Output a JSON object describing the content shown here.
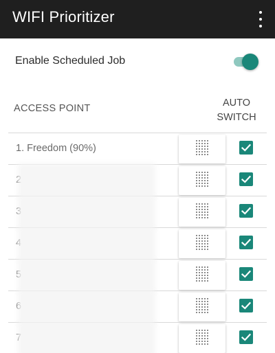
{
  "appbar": {
    "title": "WIFI Prioritizer",
    "overflow_icon": "more-vert-icon"
  },
  "schedule": {
    "label": "Enable Scheduled Job",
    "enabled": true
  },
  "columns": {
    "access_point": "ACCESS POINT",
    "auto_switch_line1": "AUTO",
    "auto_switch_line2": "SWITCH"
  },
  "colors": {
    "accent": "#1a8779",
    "toolbar": "#1f1f1f"
  },
  "networks": [
    {
      "label": "1. Freedom (90%)",
      "auto_switch": true
    },
    {
      "label": "2.",
      "auto_switch": true
    },
    {
      "label": "3.",
      "auto_switch": true
    },
    {
      "label": "4.",
      "auto_switch": true
    },
    {
      "label": "5.",
      "auto_switch": true
    },
    {
      "label": "6.",
      "auto_switch": true
    },
    {
      "label": "7.",
      "auto_switch": true
    }
  ]
}
